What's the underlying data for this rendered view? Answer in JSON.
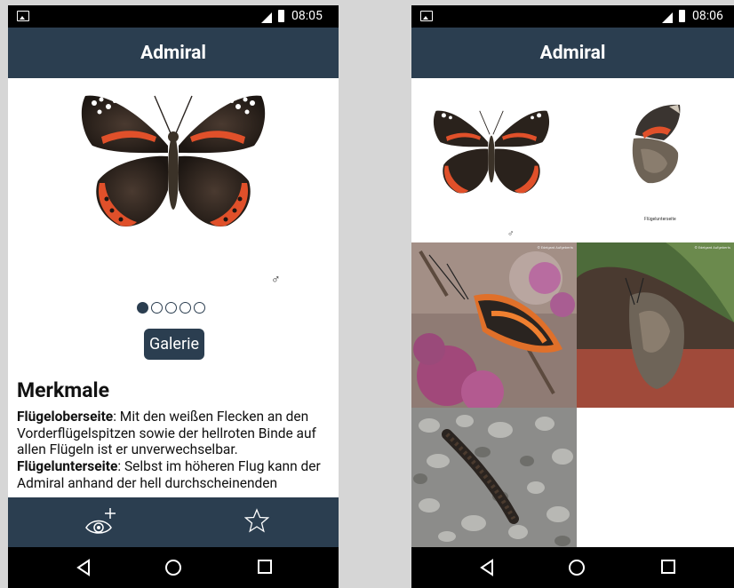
{
  "left": {
    "status": {
      "time": "08:05"
    },
    "title": "Admiral",
    "gender_symbol": "♂",
    "pager": {
      "count": 5,
      "active": 0
    },
    "gallery_button": "Galerie",
    "section_title": "Merkmale",
    "description": {
      "upper_label": "Flügeloberseite",
      "upper_text": ": Mit den weißen Flecken an den Vorderflügelspitzen sowie der hellroten Binde auf allen Flügeln ist er unverwechselbar.",
      "lower_label": "Flügelunterseite",
      "lower_text": ": Selbst im höheren Flug kann der Admiral anhand der hell durchscheinenden"
    },
    "actions": {
      "eye_icon": "eye-plus-icon",
      "star_icon": "star-outline-icon"
    }
  },
  "right": {
    "status": {
      "time": "08:06"
    },
    "title": "Admiral",
    "illustration_captions": {
      "male": "♂",
      "underside": "Flügelunterseite"
    },
    "photo_credit": "© Edelgard Aufgeberts"
  },
  "colors": {
    "primary": "#2b3e50",
    "wing_red": "#e0502a"
  }
}
